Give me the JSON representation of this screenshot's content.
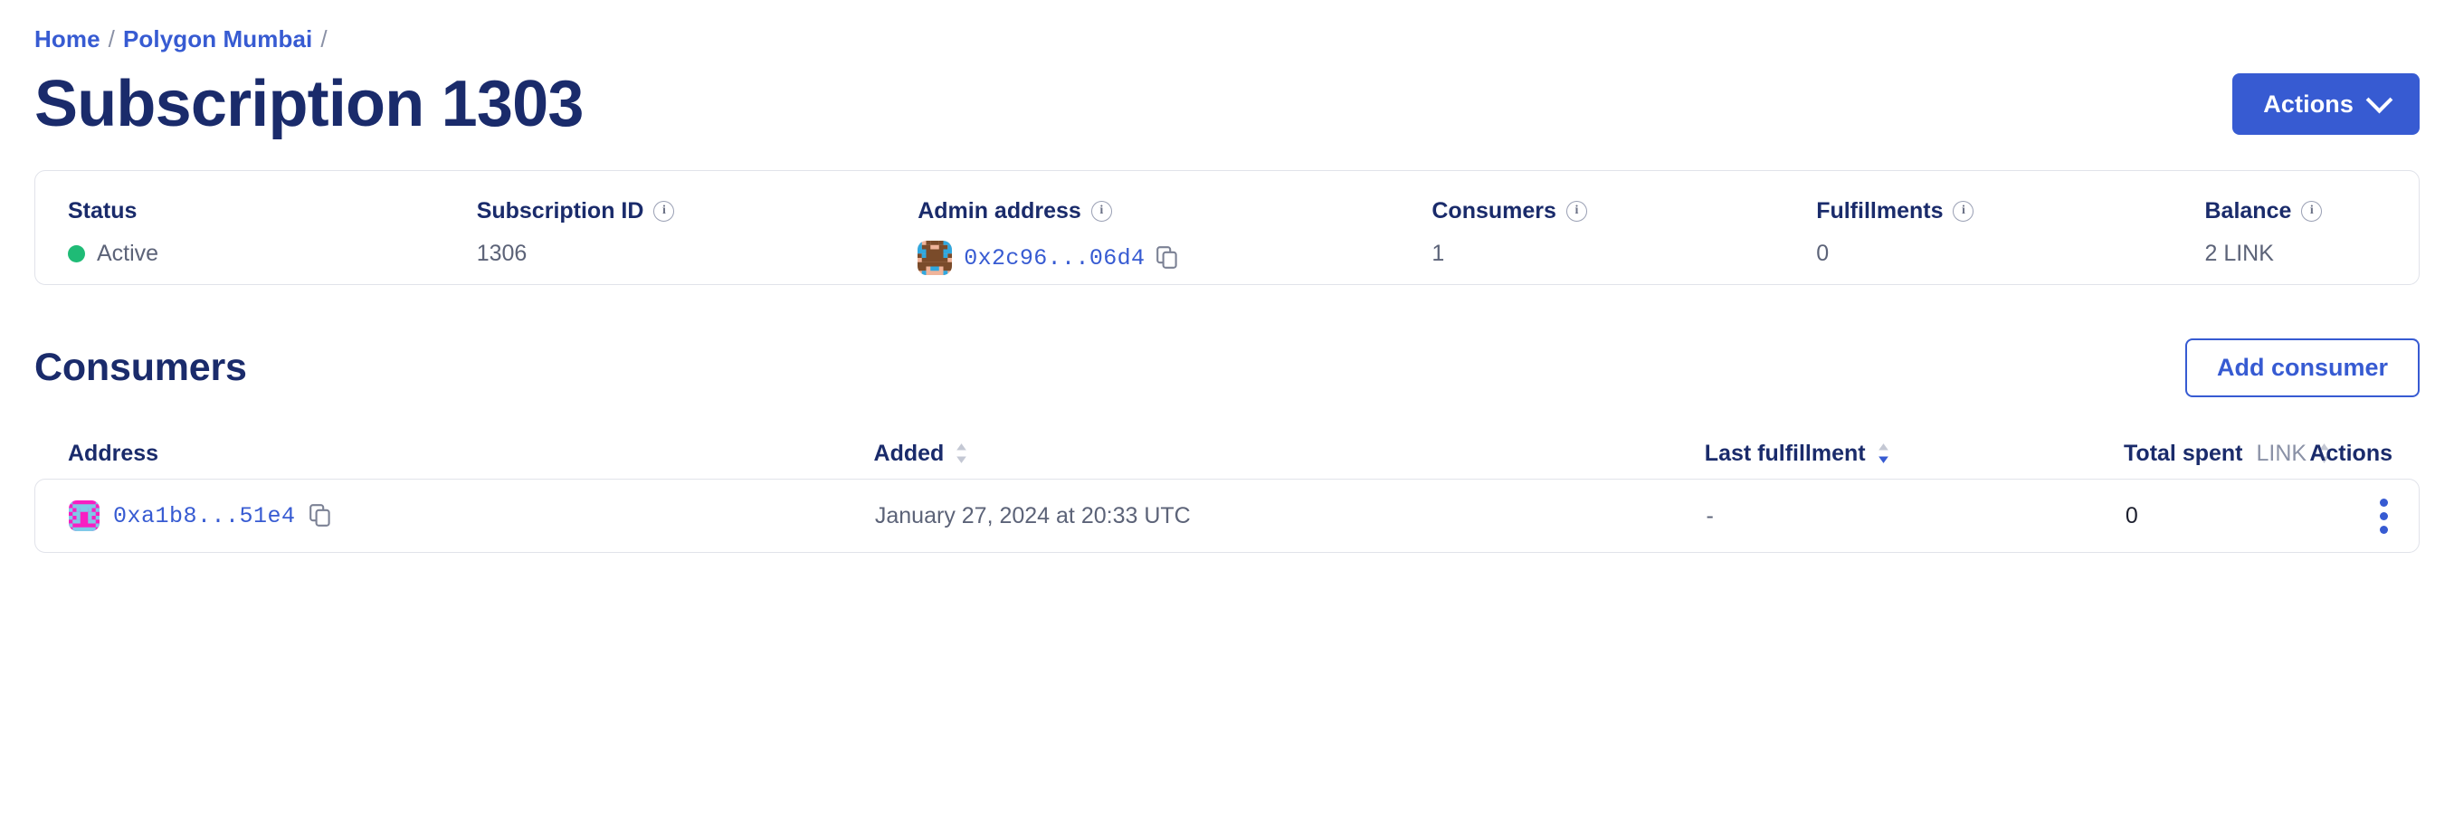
{
  "breadcrumb": {
    "items": [
      {
        "label": "Home"
      },
      {
        "label": "Polygon Mumbai"
      }
    ],
    "separator": "/"
  },
  "header": {
    "title": "Subscription 1303",
    "actions_button": "Actions"
  },
  "stats": [
    {
      "label": "Status",
      "value": "Active",
      "has_info": false,
      "kind": "status"
    },
    {
      "label": "Subscription ID",
      "value": "1306",
      "has_info": true,
      "kind": "text"
    },
    {
      "label": "Admin address",
      "value": "0x2c96...06d4",
      "has_info": true,
      "kind": "address"
    },
    {
      "label": "Consumers",
      "value": "1",
      "has_info": true,
      "kind": "text"
    },
    {
      "label": "Fulfillments",
      "value": "0",
      "has_info": true,
      "kind": "text"
    },
    {
      "label": "Balance",
      "value": "2 LINK",
      "has_info": true,
      "kind": "text"
    }
  ],
  "consumers": {
    "section_title": "Consumers",
    "add_button": "Add consumer",
    "columns": {
      "address": "Address",
      "added": "Added",
      "last_fulfillment": "Last fulfillment",
      "total_spent": "Total spent",
      "total_spent_unit": "LINK",
      "actions": "Actions"
    },
    "rows": [
      {
        "address": "0xa1b8...51e4",
        "added": "January 27, 2024 at 20:33 UTC",
        "last_fulfillment": "-",
        "total_spent": "0"
      }
    ]
  },
  "colors": {
    "brand_blue": "#375BD2",
    "navy": "#1A2B6B",
    "status_green": "#1FBB76",
    "muted": "#5C6378",
    "border": "#E1E3EA"
  }
}
